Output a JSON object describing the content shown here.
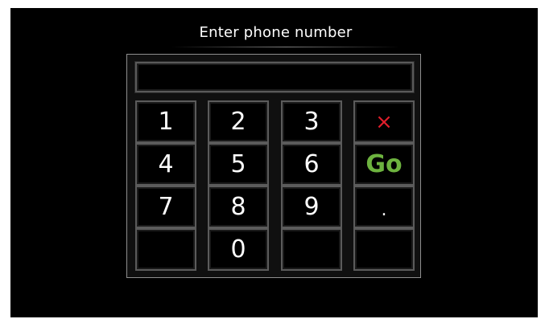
{
  "header": {
    "title": "Enter phone number"
  },
  "display": {
    "value": ""
  },
  "keys": {
    "k1": "1",
    "k2": "2",
    "k3": "3",
    "k4": "4",
    "k5": "5",
    "k6": "6",
    "k7": "7",
    "k8": "8",
    "k9": "9",
    "k0": "0",
    "delete": "×",
    "go": "Go",
    "dot": "."
  },
  "colors": {
    "background": "#000000",
    "text": "#ffffff",
    "delete": "#e01e2b",
    "go": "#6db33f",
    "key_border": "#5b5b5b"
  }
}
